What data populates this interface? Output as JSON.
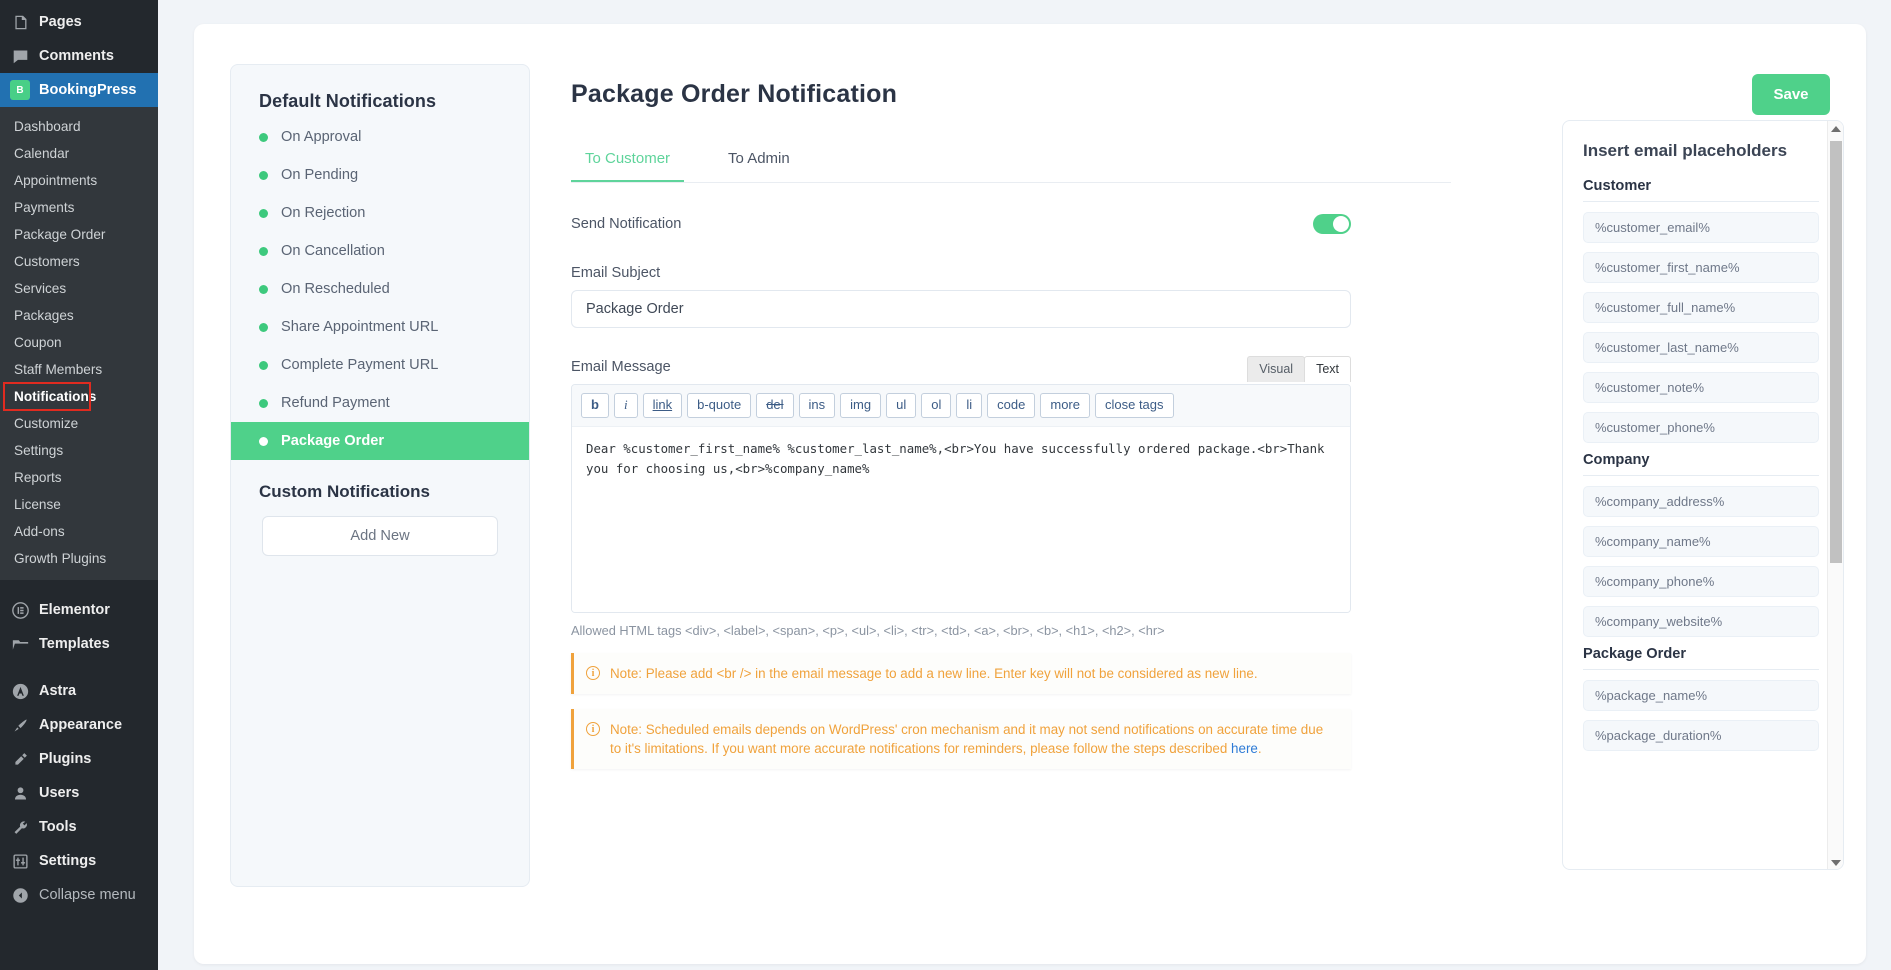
{
  "wp_sidebar": {
    "top_items": [
      {
        "label": "Pages",
        "icon": "pages-icon"
      },
      {
        "label": "Comments",
        "icon": "comments-icon"
      }
    ],
    "plugin": {
      "label": "BookingPress",
      "icon": "bookingpress-logo-icon",
      "logo_text": "B"
    },
    "plugin_items": [
      {
        "label": "Dashboard",
        "active": false
      },
      {
        "label": "Calendar",
        "active": false
      },
      {
        "label": "Appointments",
        "active": false
      },
      {
        "label": "Payments",
        "active": false
      },
      {
        "label": "Package Order",
        "active": false
      },
      {
        "label": "Customers",
        "active": false
      },
      {
        "label": "Services",
        "active": false
      },
      {
        "label": "Packages",
        "active": false
      },
      {
        "label": "Coupon",
        "active": false
      },
      {
        "label": "Staff Members",
        "active": false
      },
      {
        "label": "Notifications",
        "active": true
      },
      {
        "label": "Customize",
        "active": false
      },
      {
        "label": "Settings",
        "active": false
      },
      {
        "label": "Reports",
        "active": false
      },
      {
        "label": "License",
        "active": false
      },
      {
        "label": "Add-ons",
        "active": false
      },
      {
        "label": "Growth Plugins",
        "active": false
      }
    ],
    "bottom_groups": [
      [
        {
          "label": "Elementor",
          "icon": "elementor-icon"
        },
        {
          "label": "Templates",
          "icon": "templates-folder-icon"
        }
      ],
      [
        {
          "label": "Astra",
          "icon": "astra-icon"
        },
        {
          "label": "Appearance",
          "icon": "appearance-brush-icon"
        },
        {
          "label": "Plugins",
          "icon": "plugins-plug-icon"
        },
        {
          "label": "Users",
          "icon": "users-icon"
        },
        {
          "label": "Tools",
          "icon": "tools-wrench-icon"
        },
        {
          "label": "Settings",
          "icon": "settings-sliders-icon"
        },
        {
          "label": "Collapse menu",
          "icon": "collapse-arrow-icon"
        }
      ]
    ],
    "active_highlight_color": "#e02b20"
  },
  "notifications_panel": {
    "default_title": "Default Notifications",
    "items": [
      {
        "label": "On Approval",
        "selected": false
      },
      {
        "label": "On Pending",
        "selected": false
      },
      {
        "label": "On Rejection",
        "selected": false
      },
      {
        "label": "On Cancellation",
        "selected": false
      },
      {
        "label": "On Rescheduled",
        "selected": false
      },
      {
        "label": "Share Appointment URL",
        "selected": false
      },
      {
        "label": "Complete Payment URL",
        "selected": false
      },
      {
        "label": "Refund Payment",
        "selected": false
      },
      {
        "label": "Package Order",
        "selected": true
      }
    ],
    "custom_title": "Custom Notifications",
    "add_new_label": "Add New",
    "dot_color": "#3dc97d",
    "selected_bg": "#4fd18a"
  },
  "main": {
    "page_title": "Package Order Notification",
    "save_label": "Save",
    "save_color": "#4fd18a",
    "tabs": [
      {
        "label": "To Customer",
        "active": true
      },
      {
        "label": "To Admin",
        "active": false
      }
    ],
    "send_notification_label": "Send Notification",
    "send_notification_on": true,
    "email_subject_label": "Email Subject",
    "email_subject_value": "Package Order",
    "email_subject_placeholder": "Email Subject",
    "email_message_label": "Email Message",
    "editor_modes": [
      {
        "label": "Visual",
        "active": false
      },
      {
        "label": "Text",
        "active": true
      }
    ],
    "toolbar_buttons": [
      "b",
      "i",
      "link",
      "b-quote",
      "del",
      "ins",
      "img",
      "ul",
      "ol",
      "li",
      "code",
      "more",
      "close tags"
    ],
    "email_message_value": "Dear %customer_first_name% %customer_last_name%,<br>You have successfully ordered package.<br>Thank you for choosing us,<br>%company_name%",
    "allowed_tags_text": "Allowed HTML tags <div>, <label>, <span>, <p>, <ul>, <li>, <tr>, <td>, <a>, <br>, <b>, <h1>, <h2>, <hr>",
    "notes": [
      {
        "icon": "info-icon",
        "text": "Note: Please add <br /> in the email message to add a new line. Enter key will not be considered as new line.",
        "link_text": "",
        "link_suffix": ""
      },
      {
        "icon": "info-icon",
        "text": "Note: Scheduled emails depends on WordPress' cron mechanism and it may not send notifications on accurate time due to it's limitations. If you want more accurate notifications for reminders, please follow the steps described ",
        "link_text": "here",
        "link_suffix": "."
      }
    ],
    "note_accent_color": "#f0a23c"
  },
  "placeholders_panel": {
    "title": "Insert email placeholders",
    "groups": [
      {
        "title": "Customer",
        "items": [
          "%customer_email%",
          "%customer_first_name%",
          "%customer_full_name%",
          "%customer_last_name%",
          "%customer_note%",
          "%customer_phone%"
        ]
      },
      {
        "title": "Company",
        "items": [
          "%company_address%",
          "%company_name%",
          "%company_phone%",
          "%company_website%"
        ]
      },
      {
        "title": "Package Order",
        "items": [
          "%package_name%",
          "%package_duration%"
        ]
      }
    ]
  }
}
